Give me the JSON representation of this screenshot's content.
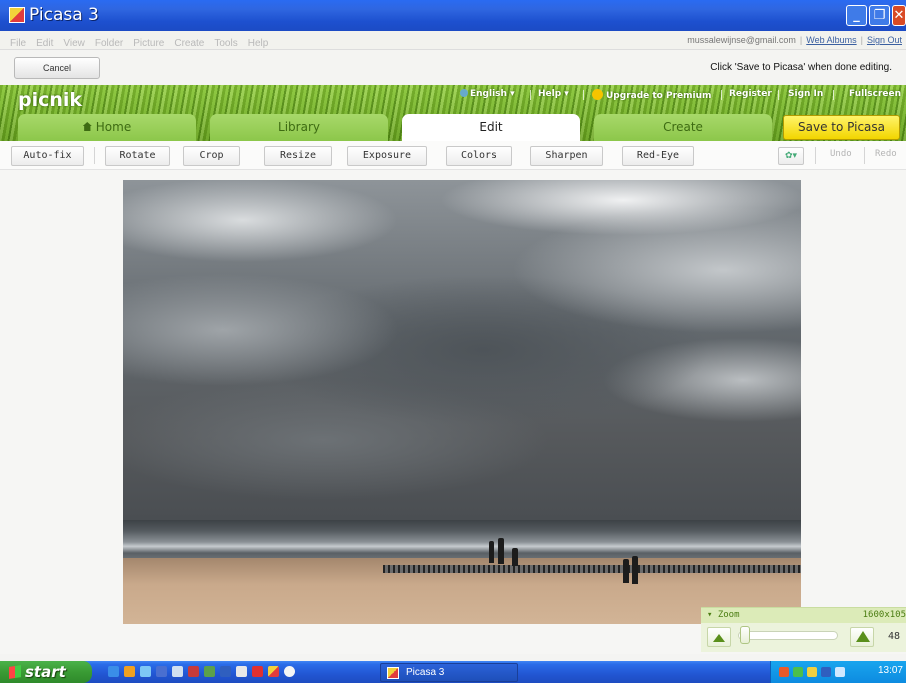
{
  "window": {
    "title": "Picasa 3"
  },
  "menu": [
    "File",
    "Edit",
    "View",
    "Folder",
    "Picture",
    "Create",
    "Tools",
    "Help"
  ],
  "account": {
    "email": "mussalewijnse@gmail.com",
    "web_albums": "Web Albums",
    "sign_out": "Sign Out"
  },
  "cancel_row": {
    "cancel_label": "Cancel",
    "hint": "Click 'Save to Picasa' when done editing."
  },
  "picnik": {
    "logo": "picnik",
    "top_links": {
      "english": "English ▾",
      "help": "Help ▾",
      "upgrade": "Upgrade to Premium",
      "register": "Register",
      "sign_in": "Sign In",
      "fullscreen": "Fullscreen"
    },
    "tabs": [
      "Home",
      "Library",
      "Edit",
      "Create"
    ],
    "active_tab": "Edit",
    "save_label": "Save to Picasa",
    "tools": [
      "Auto-fix",
      "Rotate",
      "Crop",
      "Resize",
      "Exposure",
      "Colors",
      "Sharpen",
      "Red-Eye"
    ],
    "undo": "Undo",
    "redo": "Redo",
    "gear": "✿▾"
  },
  "zoom": {
    "label": "▾ Zoom",
    "dimensions": "1600x105",
    "percent": "48"
  },
  "taskbar": {
    "start_label": "start",
    "task_label": "Picasa 3",
    "clock": "13:07"
  },
  "colors": {
    "titlebar": "#2f66e0",
    "grass": "#7cba2c",
    "save_button": "#f7e02a",
    "taskbar": "#245edc",
    "start": "#3a9b34"
  }
}
